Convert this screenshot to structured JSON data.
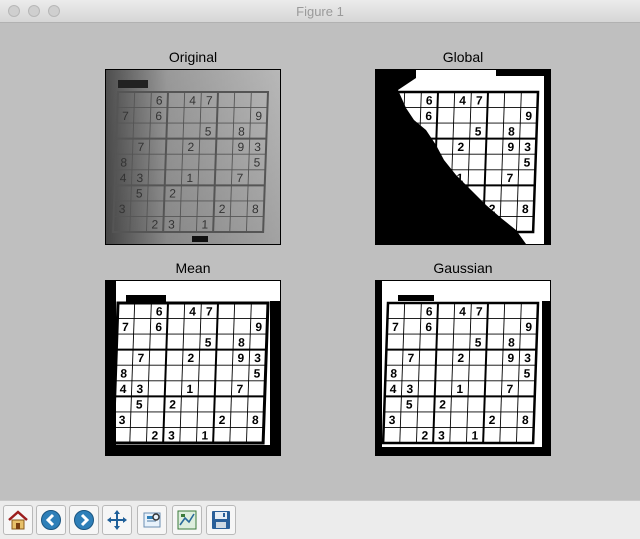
{
  "window": {
    "title": "Figure 1"
  },
  "panels": [
    {
      "title": "Original"
    },
    {
      "title": "Global"
    },
    {
      "title": "Mean"
    },
    {
      "title": "Gaussian"
    }
  ],
  "grid": [
    [
      "",
      "",
      "6",
      "",
      "4",
      "7",
      "",
      "",
      ""
    ],
    [
      "7",
      "",
      "6",
      "",
      "",
      "",
      "",
      "",
      "9"
    ],
    [
      "",
      "",
      "",
      "",
      "",
      "5",
      "",
      "8",
      ""
    ],
    [
      "",
      "7",
      "",
      "",
      "2",
      "",
      "",
      "9",
      "3"
    ],
    [
      "8",
      "",
      "",
      "",
      "",
      "",
      "",
      "",
      "5"
    ],
    [
      "4",
      "3",
      "",
      "",
      "1",
      "",
      "",
      "7",
      ""
    ],
    [
      "",
      "5",
      "",
      "2",
      "",
      "",
      "",
      "",
      ""
    ],
    [
      "3",
      "",
      "",
      "",
      "",
      "",
      "2",
      "",
      "8"
    ],
    [
      "",
      "",
      "2",
      "3",
      "",
      "1",
      "",
      "",
      ""
    ]
  ],
  "toolbar": {
    "buttons": [
      {
        "name": "home",
        "icon": "home-icon"
      },
      {
        "name": "back",
        "icon": "back-arrow-icon"
      },
      {
        "name": "forward",
        "icon": "forward-arrow-icon"
      },
      {
        "name": "pan",
        "icon": "move-icon"
      },
      {
        "name": "zoom",
        "icon": "zoom-rect-icon"
      },
      {
        "name": "subplots",
        "icon": "subplots-icon"
      },
      {
        "name": "save",
        "icon": "save-icon"
      }
    ]
  }
}
